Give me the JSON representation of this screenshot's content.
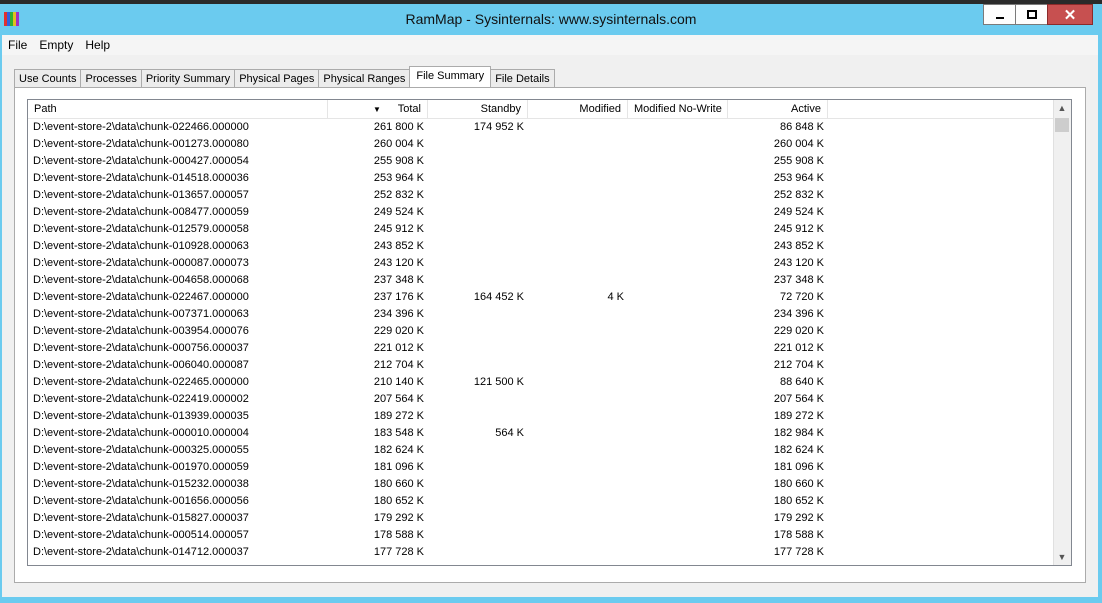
{
  "window": {
    "title": "RamMap - Sysinternals: www.sysinternals.com"
  },
  "menu": [
    "File",
    "Empty",
    "Help"
  ],
  "tabs": [
    {
      "label": "Use Counts",
      "active": false
    },
    {
      "label": "Processes",
      "active": false
    },
    {
      "label": "Priority Summary",
      "active": false
    },
    {
      "label": "Physical Pages",
      "active": false
    },
    {
      "label": "Physical Ranges",
      "active": false
    },
    {
      "label": "File Summary",
      "active": true
    },
    {
      "label": "File Details",
      "active": false
    }
  ],
  "table": {
    "columns": {
      "path": "Path",
      "total": "Total",
      "standby": "Standby",
      "modified": "Modified",
      "modified_no_write": "Modified No-Write",
      "active": "Active"
    },
    "sort_column": "total",
    "rows": [
      {
        "path": "D:\\event-store-2\\data\\chunk-022466.000000",
        "total": "261 800 K",
        "standby": "174 952 K",
        "modified": "",
        "mnw": "",
        "active": "86 848 K"
      },
      {
        "path": "D:\\event-store-2\\data\\chunk-001273.000080",
        "total": "260 004 K",
        "standby": "",
        "modified": "",
        "mnw": "",
        "active": "260 004 K"
      },
      {
        "path": "D:\\event-store-2\\data\\chunk-000427.000054",
        "total": "255 908 K",
        "standby": "",
        "modified": "",
        "mnw": "",
        "active": "255 908 K"
      },
      {
        "path": "D:\\event-store-2\\data\\chunk-014518.000036",
        "total": "253 964 K",
        "standby": "",
        "modified": "",
        "mnw": "",
        "active": "253 964 K"
      },
      {
        "path": "D:\\event-store-2\\data\\chunk-013657.000057",
        "total": "252 832 K",
        "standby": "",
        "modified": "",
        "mnw": "",
        "active": "252 832 K"
      },
      {
        "path": "D:\\event-store-2\\data\\chunk-008477.000059",
        "total": "249 524 K",
        "standby": "",
        "modified": "",
        "mnw": "",
        "active": "249 524 K"
      },
      {
        "path": "D:\\event-store-2\\data\\chunk-012579.000058",
        "total": "245 912 K",
        "standby": "",
        "modified": "",
        "mnw": "",
        "active": "245 912 K"
      },
      {
        "path": "D:\\event-store-2\\data\\chunk-010928.000063",
        "total": "243 852 K",
        "standby": "",
        "modified": "",
        "mnw": "",
        "active": "243 852 K"
      },
      {
        "path": "D:\\event-store-2\\data\\chunk-000087.000073",
        "total": "243 120 K",
        "standby": "",
        "modified": "",
        "mnw": "",
        "active": "243 120 K"
      },
      {
        "path": "D:\\event-store-2\\data\\chunk-004658.000068",
        "total": "237 348 K",
        "standby": "",
        "modified": "",
        "mnw": "",
        "active": "237 348 K"
      },
      {
        "path": "D:\\event-store-2\\data\\chunk-022467.000000",
        "total": "237 176 K",
        "standby": "164 452 K",
        "modified": "4 K",
        "mnw": "",
        "active": "72 720 K"
      },
      {
        "path": "D:\\event-store-2\\data\\chunk-007371.000063",
        "total": "234 396 K",
        "standby": "",
        "modified": "",
        "mnw": "",
        "active": "234 396 K"
      },
      {
        "path": "D:\\event-store-2\\data\\chunk-003954.000076",
        "total": "229 020 K",
        "standby": "",
        "modified": "",
        "mnw": "",
        "active": "229 020 K"
      },
      {
        "path": "D:\\event-store-2\\data\\chunk-000756.000037",
        "total": "221 012 K",
        "standby": "",
        "modified": "",
        "mnw": "",
        "active": "221 012 K"
      },
      {
        "path": "D:\\event-store-2\\data\\chunk-006040.000087",
        "total": "212 704 K",
        "standby": "",
        "modified": "",
        "mnw": "",
        "active": "212 704 K"
      },
      {
        "path": "D:\\event-store-2\\data\\chunk-022465.000000",
        "total": "210 140 K",
        "standby": "121 500 K",
        "modified": "",
        "mnw": "",
        "active": "88 640 K"
      },
      {
        "path": "D:\\event-store-2\\data\\chunk-022419.000002",
        "total": "207 564 K",
        "standby": "",
        "modified": "",
        "mnw": "",
        "active": "207 564 K"
      },
      {
        "path": "D:\\event-store-2\\data\\chunk-013939.000035",
        "total": "189 272 K",
        "standby": "",
        "modified": "",
        "mnw": "",
        "active": "189 272 K"
      },
      {
        "path": "D:\\event-store-2\\data\\chunk-000010.000004",
        "total": "183 548 K",
        "standby": "564 K",
        "modified": "",
        "mnw": "",
        "active": "182 984 K"
      },
      {
        "path": "D:\\event-store-2\\data\\chunk-000325.000055",
        "total": "182 624 K",
        "standby": "",
        "modified": "",
        "mnw": "",
        "active": "182 624 K"
      },
      {
        "path": "D:\\event-store-2\\data\\chunk-001970.000059",
        "total": "181 096 K",
        "standby": "",
        "modified": "",
        "mnw": "",
        "active": "181 096 K"
      },
      {
        "path": "D:\\event-store-2\\data\\chunk-015232.000038",
        "total": "180 660 K",
        "standby": "",
        "modified": "",
        "mnw": "",
        "active": "180 660 K"
      },
      {
        "path": "D:\\event-store-2\\data\\chunk-001656.000056",
        "total": "180 652 K",
        "standby": "",
        "modified": "",
        "mnw": "",
        "active": "180 652 K"
      },
      {
        "path": "D:\\event-store-2\\data\\chunk-015827.000037",
        "total": "179 292 K",
        "standby": "",
        "modified": "",
        "mnw": "",
        "active": "179 292 K"
      },
      {
        "path": "D:\\event-store-2\\data\\chunk-000514.000057",
        "total": "178 588 K",
        "standby": "",
        "modified": "",
        "mnw": "",
        "active": "178 588 K"
      },
      {
        "path": "D:\\event-store-2\\data\\chunk-014712.000037",
        "total": "177 728 K",
        "standby": "",
        "modified": "",
        "mnw": "",
        "active": "177 728 K"
      }
    ]
  },
  "colors": {
    "frame": "#6bcbef",
    "close_button": "#c75050",
    "app_icon": [
      "#e03030",
      "#3060e0",
      "#30b030",
      "#e0c020",
      "#a030c0"
    ]
  },
  "icons": {
    "app": "rammap-icon",
    "minimize": "minimize-icon",
    "maximize": "maximize-icon",
    "close": "close-icon",
    "sort": "sort-arrow-icon",
    "scroll_up": "chevron-up-icon",
    "scroll_down": "chevron-down-icon"
  }
}
